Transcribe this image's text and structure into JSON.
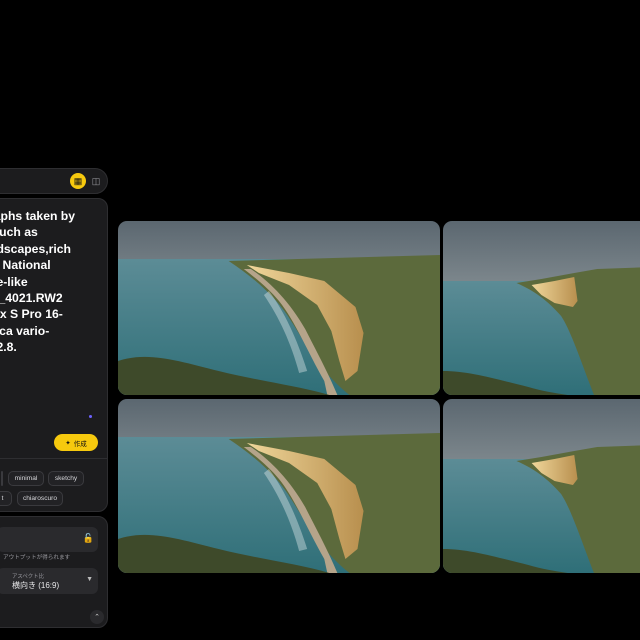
{
  "prompt": {
    "text": "raphs taken by\n such as\nndscapes,rich\ns, National\nne-like\nG_4021.RW2\nnix S Pro 16-\neica vario-\n f2.8."
  },
  "create_button": {
    "label": "作成",
    "icon": "sparkle-icon"
  },
  "style_chips": [
    "minimal",
    "sketchy",
    "t",
    "chiaroscuro"
  ],
  "settings": {
    "note": "アウトプットが得られます",
    "aspect_label": "アスペクト比",
    "aspect_value": "横向き (16:9)"
  },
  "toolbar": {
    "icons": [
      "grid-view-icon",
      "compare-icon"
    ]
  },
  "images": [
    {
      "alt": "Chalk cliffs coastline view 1",
      "focus": "cliffs"
    },
    {
      "alt": "Chalk cliffs coastline view 2",
      "focus": "sea"
    },
    {
      "alt": "Chalk cliffs coastline view 3",
      "focus": "cliffs"
    },
    {
      "alt": "Chalk cliffs coastline view 4",
      "focus": "sea"
    }
  ],
  "colors": {
    "accent": "#f6c90e",
    "panel": "#1c1c1e",
    "background": "#000000",
    "dot": "#6d62ff"
  }
}
